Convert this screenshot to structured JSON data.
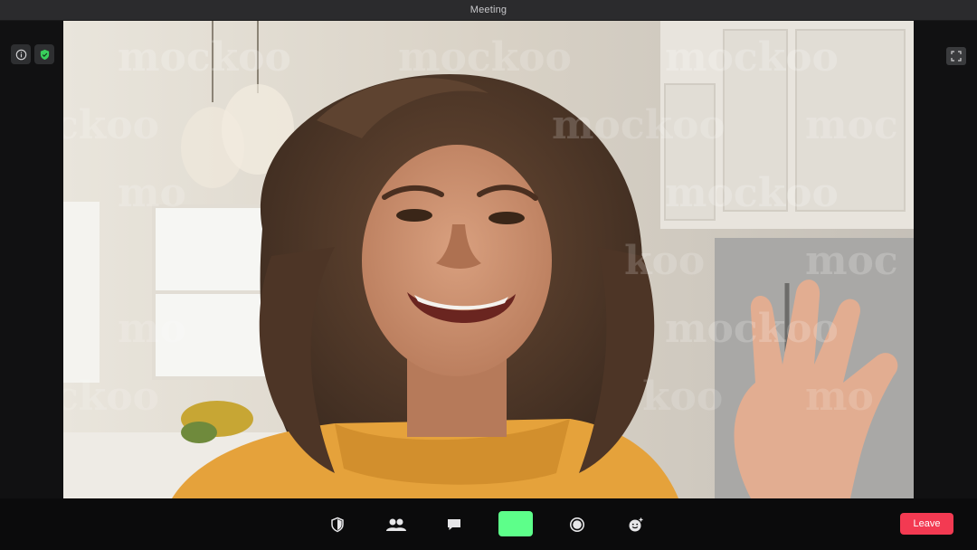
{
  "window": {
    "title": "Meeting"
  },
  "top_left": {
    "info_icon": "info-icon",
    "security_icon": "shield-check-icon",
    "security_color": "#39d05c"
  },
  "fullscreen_icon": "fullscreen-icon",
  "video": {
    "watermark_text": "mockoo"
  },
  "toolbar": {
    "buttons": [
      {
        "icon": "shield-icon",
        "name": "security"
      },
      {
        "icon": "participants-icon",
        "name": "participants"
      },
      {
        "icon": "chat-icon",
        "name": "chat"
      },
      {
        "icon": "video-icon",
        "name": "video",
        "color": "#5dff8a"
      },
      {
        "icon": "record-icon",
        "name": "record"
      },
      {
        "icon": "reactions-icon",
        "name": "reactions"
      }
    ],
    "leave_label": "Leave",
    "leave_color": "#f33a52"
  }
}
